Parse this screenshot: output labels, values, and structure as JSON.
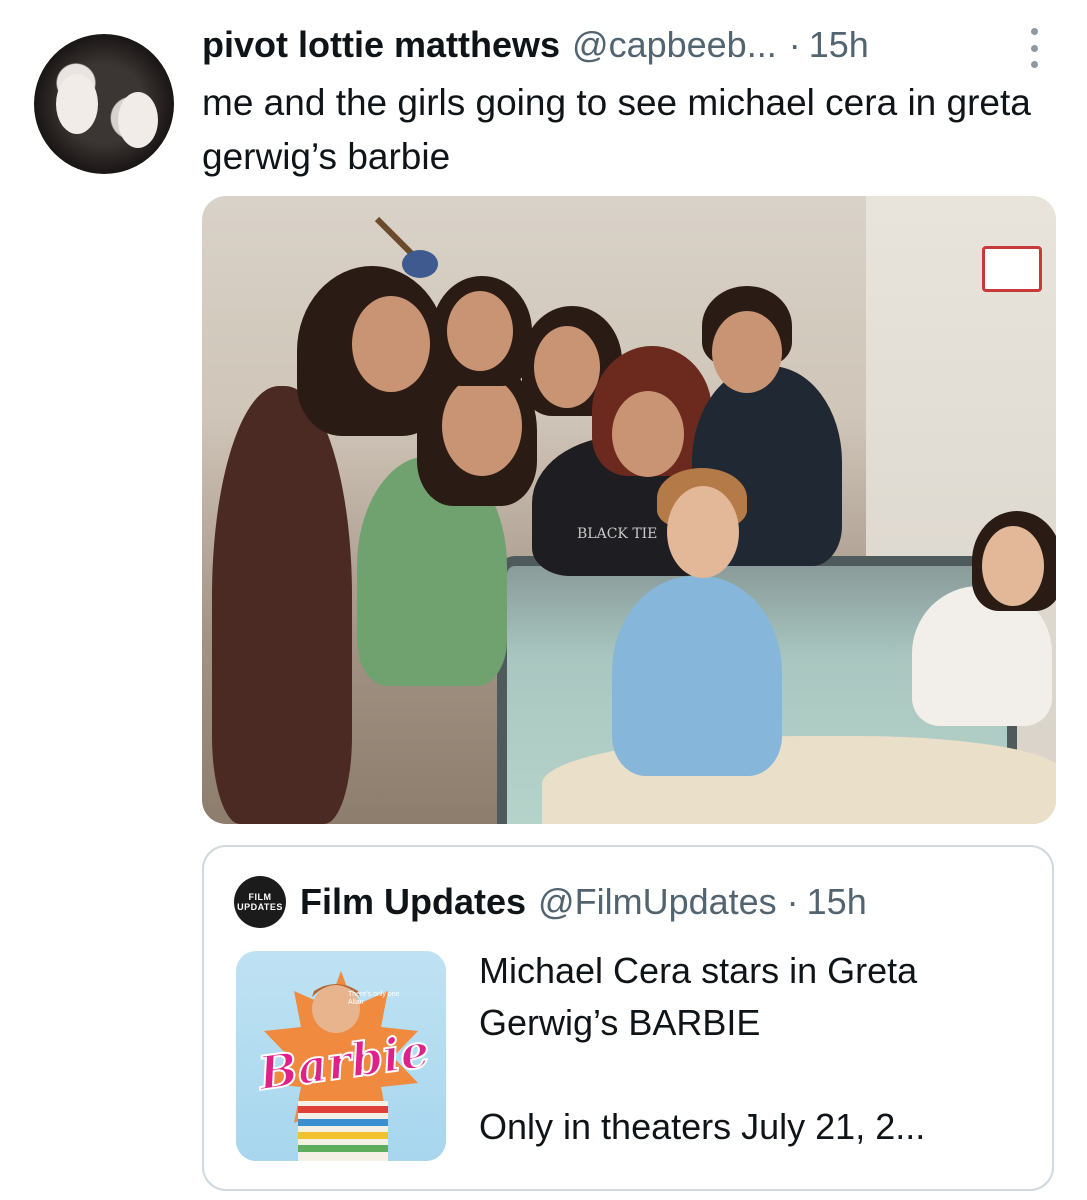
{
  "tweet": {
    "display_name": "pivot lottie matthews",
    "handle": "@capbeeb...",
    "separator": "·",
    "time": "15h",
    "text": "me and the girls going to see michael cera in greta gerwig’s barbie",
    "avatar_icon": "profile-photo",
    "more_icon": "more-vertical-icon",
    "photo": {
      "type": "photo",
      "sign_text": "",
      "shirt_text": "BLACK TIE"
    }
  },
  "quote": {
    "display_name": "Film Updates",
    "handle": "@FilmUpdates",
    "separator": "·",
    "time": "15h",
    "avatar_text_1": "FILM",
    "avatar_text_2": "UPDATES",
    "text_line_1": "Michael Cera stars in Greta",
    "text_line_2": "Gerwig’s BARBIE",
    "text_line_3": "Only in theaters July 21, 2...",
    "thumb_logo": "Barbie",
    "thumb_small_text": "There's only one Allan"
  },
  "colors": {
    "text_primary": "#0f1419",
    "text_secondary": "#536471",
    "border": "#cfd9de",
    "barbie_pink": "#e0218a"
  }
}
